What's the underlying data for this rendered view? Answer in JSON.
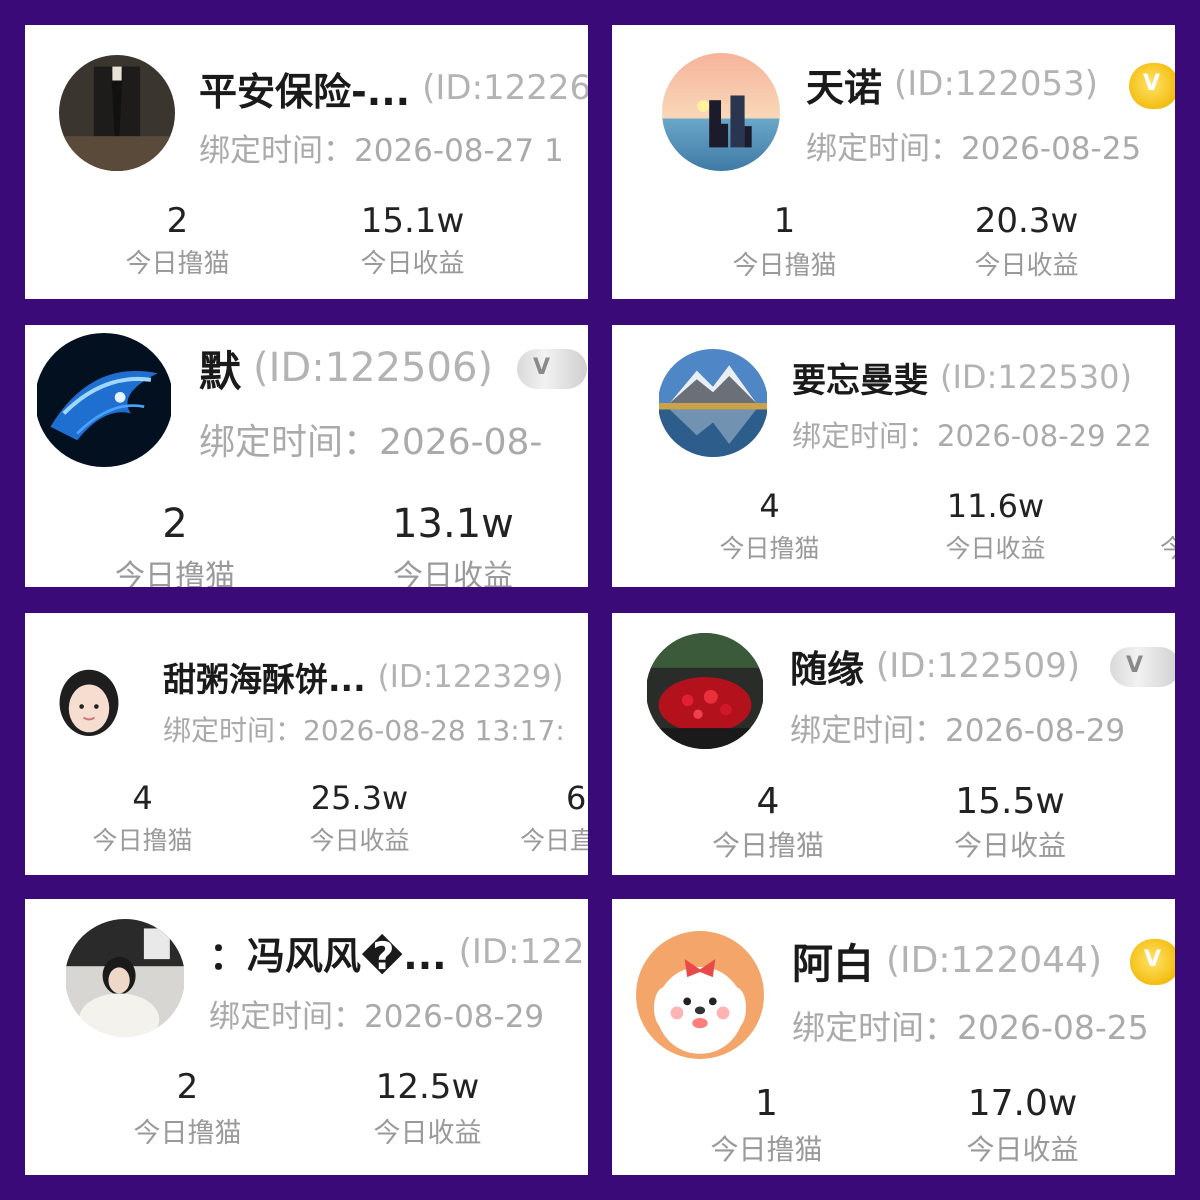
{
  "cards": [
    {
      "name": "平安保险-...",
      "id_text": "(ID:12226",
      "bind_text": "绑定时间：2026-08-27 1",
      "stats": [
        {
          "value": "2",
          "label": "今日撸猫"
        },
        {
          "value": "15.1w",
          "label": "今日收益"
        }
      ]
    },
    {
      "name": "天诺",
      "id_text": "(ID:122053)",
      "bind_text": "绑定时间：2026-08-25",
      "badge": "gold-badge-icon",
      "stats": [
        {
          "value": "1",
          "label": "今日撸猫"
        },
        {
          "value": "20.3w",
          "label": "今日收益"
        }
      ]
    },
    {
      "name": "默",
      "id_text": "(ID:122506)",
      "bind_text": "绑定时间：2026-08-",
      "badge": "silver-badge-icon",
      "stats": [
        {
          "value": "2",
          "label": "今日撸猫"
        },
        {
          "value": "13.1w",
          "label": "今日收益"
        }
      ]
    },
    {
      "name": "要忘曼斐",
      "id_text": "(ID:122530)",
      "bind_text": "绑定时间：2026-08-29 22",
      "stats": [
        {
          "value": "4",
          "label": "今日撸猫"
        },
        {
          "value": "11.6w",
          "label": "今日收益"
        },
        {
          "value": "",
          "label": "今"
        }
      ]
    },
    {
      "name": "甜粥海酥饼...",
      "id_text": "(ID:122329)",
      "bind_text": "绑定时间：2026-08-28 13:17:",
      "stats": [
        {
          "value": "4",
          "label": "今日撸猫"
        },
        {
          "value": "25.3w",
          "label": "今日收益"
        },
        {
          "value": "6",
          "label": "今日直"
        }
      ]
    },
    {
      "name": "随缘",
      "id_text": "(ID:122509)",
      "bind_text": "绑定时间：2026-08-29",
      "badge": "silver-badge-icon",
      "stats": [
        {
          "value": "4",
          "label": "今日撸猫"
        },
        {
          "value": "15.5w",
          "label": "今日收益"
        }
      ]
    },
    {
      "name": "：冯风风�...",
      "id_text": "(ID:122",
      "bind_text": "绑定时间：2026-08-29",
      "stats": [
        {
          "value": "2",
          "label": "今日撸猫"
        },
        {
          "value": "12.5w",
          "label": "今日收益"
        }
      ]
    },
    {
      "name": "阿白",
      "id_text": "(ID:122044)",
      "bind_text": "绑定时间：2026-08-25",
      "badge": "gold-badge-icon",
      "stats": [
        {
          "value": "1",
          "label": "今日撸猫"
        },
        {
          "value": "17.0w",
          "label": "今日收益"
        }
      ]
    }
  ],
  "colors": {
    "background": "#3a0a78",
    "card": "#ffffff",
    "name": "#1a1a1a",
    "muted": "#aaaaaa",
    "gold": "#f5c21a"
  }
}
